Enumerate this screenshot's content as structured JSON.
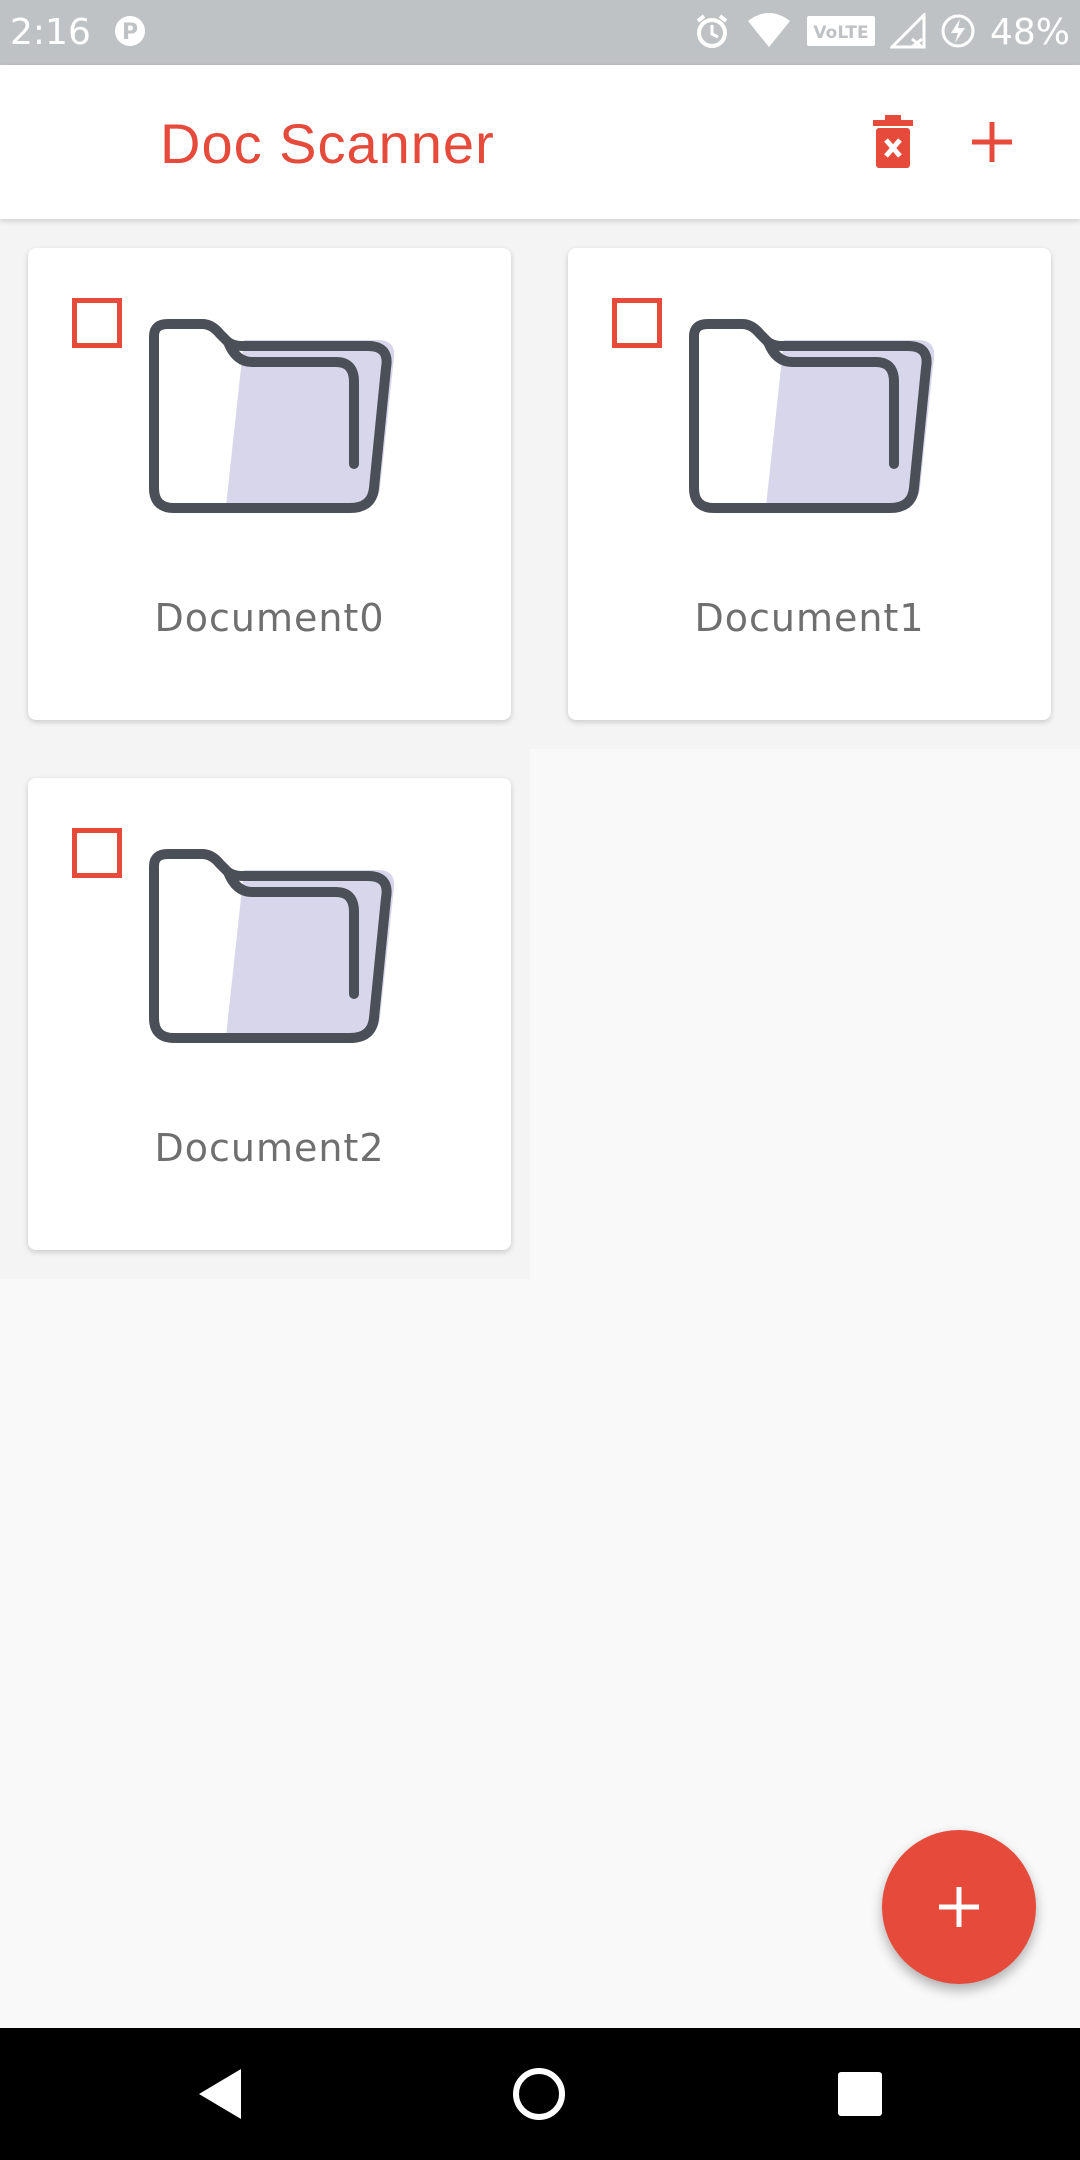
{
  "status_bar": {
    "time": "2:16",
    "battery": "48%",
    "volte": "VoLTE",
    "icons": [
      "parking-icon",
      "alarm-icon",
      "wifi-icon",
      "volte-icon",
      "signal-icon",
      "battery-charging-icon"
    ]
  },
  "app_bar": {
    "title": "Doc Scanner",
    "actions": [
      "delete-icon",
      "add-icon"
    ]
  },
  "documents": [
    {
      "name": "Document0",
      "checked": false
    },
    {
      "name": "Document1",
      "checked": false
    },
    {
      "name": "Document2",
      "checked": false
    }
  ],
  "fab": {
    "icon": "add-icon"
  },
  "nav_bar": {
    "buttons": [
      "back-icon",
      "home-icon",
      "recents-icon"
    ]
  },
  "colors": {
    "accent": "#e64a3b",
    "status_bar": "#bfc2c5",
    "folder_stroke": "#4a4f58",
    "folder_inner": "#d8d6ea",
    "label": "#6f6f6f"
  }
}
